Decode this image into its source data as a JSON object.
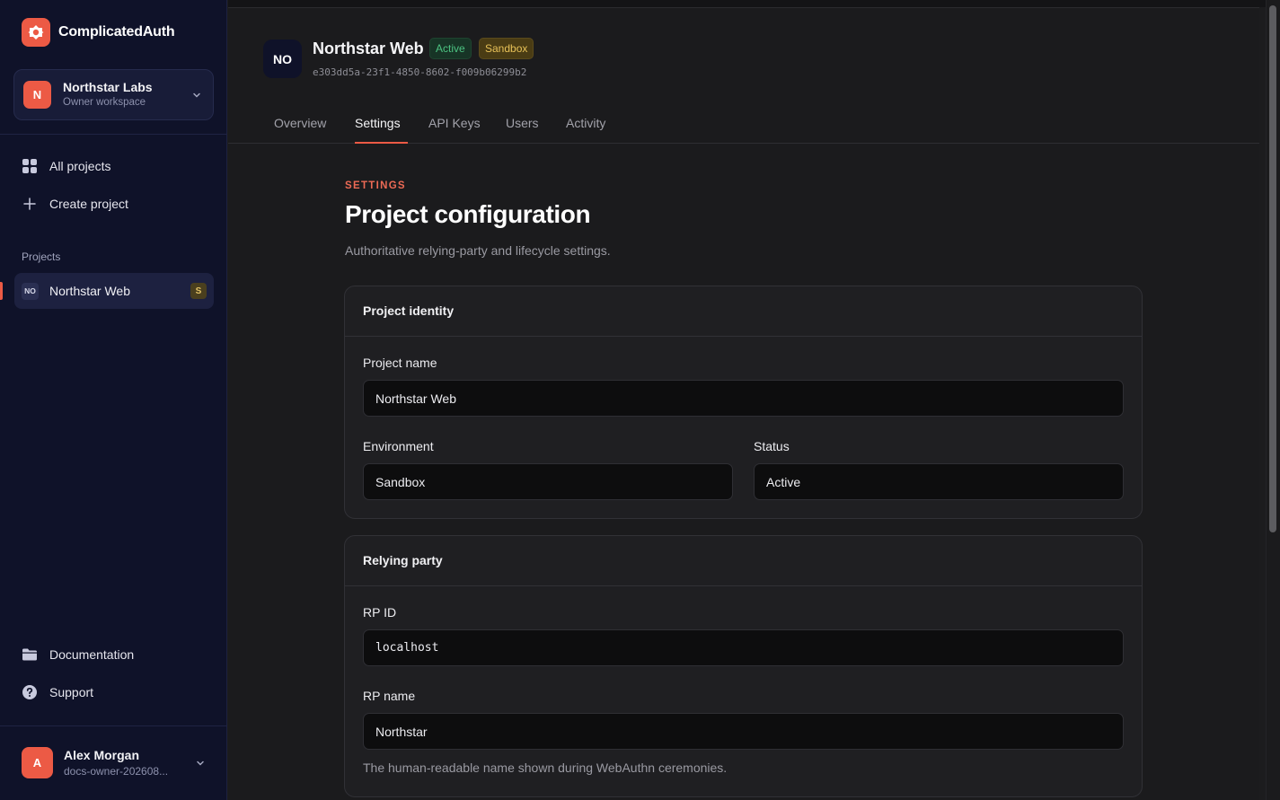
{
  "brand": {
    "name": "ComplicatedAuth",
    "accent": "#ec5a45"
  },
  "workspace": {
    "initial": "N",
    "name": "Northstar Labs",
    "role": "Owner workspace"
  },
  "nav": {
    "all_projects": "All projects",
    "create_project": "Create project",
    "projects_section": "Projects",
    "documentation": "Documentation",
    "support": "Support"
  },
  "sidebar_projects": [
    {
      "badge": "NO",
      "name": "Northstar Web",
      "env_tag": "S"
    }
  ],
  "user": {
    "initial": "A",
    "name": "Alex Morgan",
    "email": "docs-owner-202608..."
  },
  "project": {
    "initials": "NO",
    "name": "Northstar Web",
    "status_pill": "Active",
    "env_pill": "Sandbox",
    "id": "e303dd5a-23f1-4850-8602-f009b06299b2"
  },
  "tabs": [
    "Overview",
    "Settings",
    "API Keys",
    "Users",
    "Activity"
  ],
  "active_tab": "Settings",
  "page": {
    "eyebrow": "SETTINGS",
    "title": "Project configuration",
    "subtitle": "Authoritative relying-party and lifecycle settings."
  },
  "identity_card": {
    "title": "Project identity",
    "project_name_label": "Project name",
    "project_name_value": "Northstar Web",
    "environment_label": "Environment",
    "environment_value": "Sandbox",
    "status_label": "Status",
    "status_value": "Active"
  },
  "rp_card": {
    "title": "Relying party",
    "rp_id_label": "RP ID",
    "rp_id_value": "localhost",
    "rp_name_label": "RP name",
    "rp_name_value": "Northstar",
    "rp_name_help": "The human-readable name shown during WebAuthn ceremonies."
  },
  "colors": {
    "sidebar_bg": "#0f1229",
    "main_bg": "#1b1b1d",
    "active_green": "#4cc281",
    "sandbox_yellow": "#e7c158"
  }
}
